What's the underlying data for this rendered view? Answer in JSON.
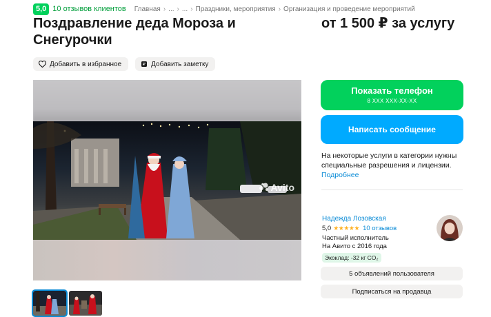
{
  "header": {
    "rating": "5,0",
    "reviews_link": "10 отзывов клиентов",
    "breadcrumbs": [
      "Главная",
      "...",
      "...",
      "Праздники, мероприятия",
      "Организация и проведение мероприятий"
    ]
  },
  "listing": {
    "title": "Поздравление деда Мороза и Снегурочки",
    "price": "от 1 500 ₽ за услугу"
  },
  "actions": {
    "favorite": "Добавить в избранное",
    "note": "Добавить заметку"
  },
  "gallery": {
    "watermark": "Avito",
    "thumbnails_count": 2,
    "active_thumbnail": 1
  },
  "contact": {
    "phone_button": "Показать телефон",
    "phone_masked": "8 XXX XXX-XX-XX",
    "message_button": "Написать сообщение"
  },
  "notice": {
    "text": "На некоторые услуги в категории нужны специальные разрешения и лицензии.",
    "more_link": "Подробнее"
  },
  "seller": {
    "name": "Надежда Лозовская",
    "rating": "5,0",
    "stars": "★★★★★",
    "reviews": "10 отзывов",
    "type": "Частный исполнитель",
    "since": "На Авито с 2016 года",
    "eco": "Экоклад: -32 кг CO₂"
  },
  "buttons": {
    "user_listings": "5 объявлений пользователя",
    "subscribe": "Подписаться на продавца"
  },
  "colors": {
    "green": "#02d15c",
    "blue": "#00aaff",
    "link": "#0a8bd6",
    "star": "#ffb021"
  }
}
